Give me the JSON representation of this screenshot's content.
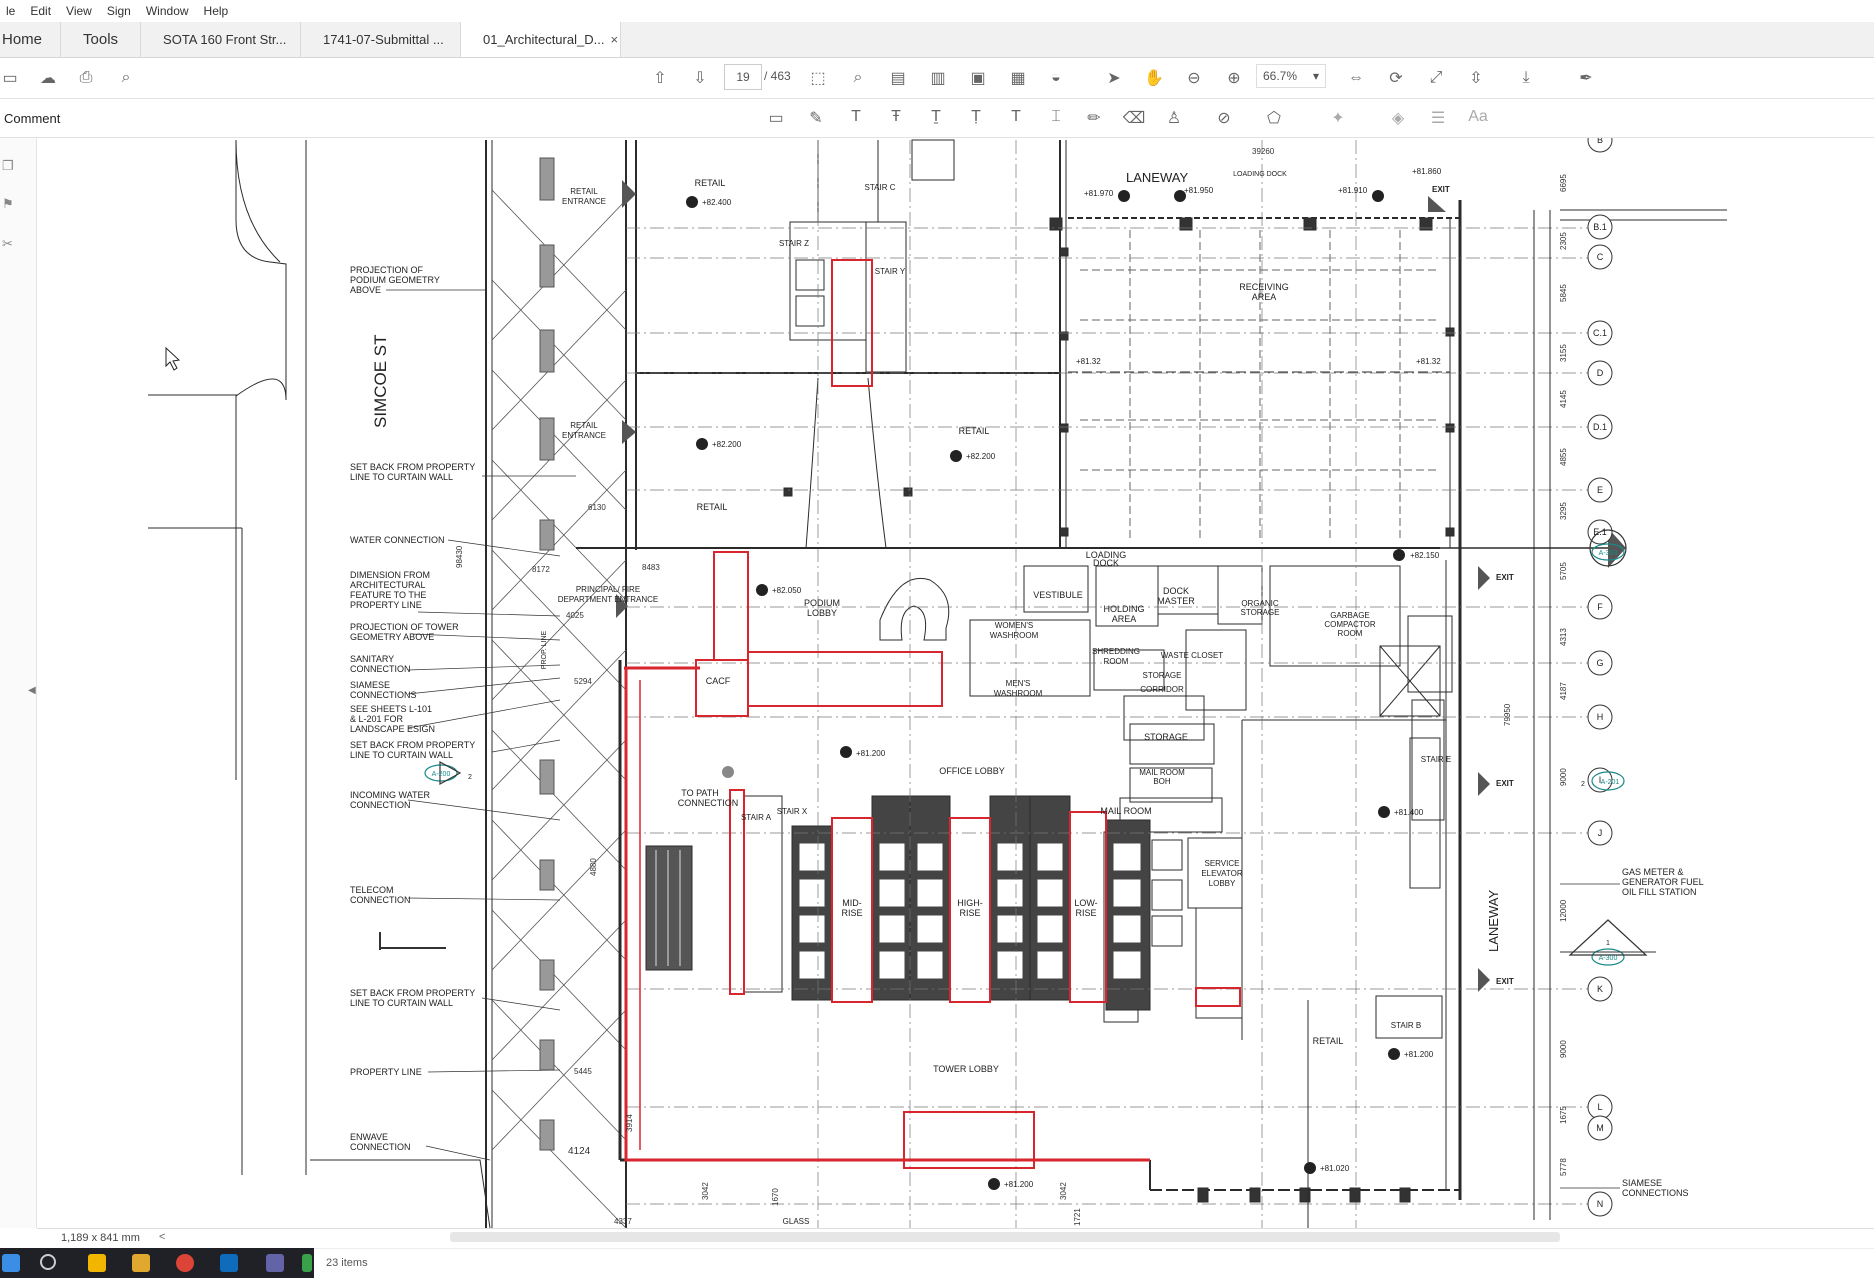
{
  "menu": [
    "le",
    "Edit",
    "View",
    "Sign",
    "Window",
    "Help"
  ],
  "tabs": {
    "home": "Home",
    "tools": "Tools",
    "docs": [
      "SOTA 160 Front Str...",
      "1741-07-Submittal ..."
    ],
    "active": "01_Architectural_D...",
    "close_glyph": "×"
  },
  "toolbar": {
    "page_current": "19",
    "page_total": "/ 463",
    "zoom": "66.7%",
    "zoom_caret": "▾"
  },
  "comment_bar": {
    "label": "Comment"
  },
  "status": {
    "dimensions": "1,189 x 841 mm",
    "chevron": "<"
  },
  "explorer": {
    "items": "23 items"
  },
  "drawing": {
    "street": "SIMCOE ST",
    "laneway_top": "LANEWAY",
    "laneway_right": "LANEWAY",
    "grid_labels": [
      "B",
      "B.1",
      "C",
      "C.1",
      "D",
      "D.1",
      "E",
      "E.1",
      "F",
      "G",
      "H",
      "I",
      "J",
      "K",
      "L",
      "M",
      "N"
    ],
    "grid_dims": [
      "6695",
      "2305",
      "5845",
      "3155",
      "4145",
      "4855",
      "3295",
      "5705",
      "4313",
      "4187",
      "9000",
      "12000",
      "9000",
      "1675",
      "5778"
    ],
    "left_notes": [
      "PROJECTION OF",
      "PODIUM GEOMETRY",
      "ABOVE",
      "SET BACK FROM PROPERTY",
      "LINE TO CURTAIN WALL",
      "WATER CONNECTION",
      "DIMENSION FROM",
      "ARCHITECTURAL",
      "FEATURE TO THE",
      "PROPERTY LINE",
      "PROJECTION OF TOWER",
      "GEOMETRY ABOVE",
      "SANITARY",
      "CONNECTION",
      "SIAMESE",
      "CONNECTIONS",
      "SEE SHEETS L-101",
      "& L-201 FOR",
      "LANDSCAPE ESIGN",
      "SET BACK FROM PROPERTY",
      "LINE TO CURTAIN WALL",
      "INCOMING WATER",
      "CONNECTION",
      "TELECOM",
      "CONNECTION",
      "SET BACK FROM PROPERTY",
      "LINE TO CURTAIN WALL",
      "PROPERTY LINE",
      "ENWAVE",
      "CONNECTION"
    ],
    "right_notes": [
      "GAS METER &",
      "GENERATOR FUEL",
      "OIL FILL STATION",
      "SIAMESE",
      "CONNECTIONS"
    ],
    "rooms": {
      "retail": "RETAIL",
      "retail_entrance_1": "RETAIL",
      "retail_entrance_2": "ENTRANCE",
      "stair_c": "STAIR C",
      "stair_z": "STAIR Z",
      "stair_y": "STAIR Y",
      "stair_a": "STAIR A",
      "stair_x": "STAIR X",
      "stair_e": "STAIR E",
      "stair_b": "STAIR B",
      "loading_dock_top": "LOADING DOCK",
      "receiving_1": "RECEIVING",
      "receiving_2": "AREA",
      "loading_dock_1": "LOADING",
      "loading_dock_2": "DOCK",
      "vestibule": "VESTIBULE",
      "holding_1": "HOLDING",
      "holding_2": "AREA",
      "dock_master_1": "DOCK",
      "dock_master_2": "MASTER",
      "organic_1": "ORGANIC",
      "organic_2": "STORAGE",
      "garbage_1": "GARBAGE",
      "garbage_2": "COMPACTOR",
      "garbage_3": "ROOM",
      "womens_1": "WOMEN'S",
      "womens_2": "WASHROOM",
      "mens_1": "MEN'S",
      "mens_2": "WASHROOM",
      "shredding_1": "SHREDDING",
      "shredding_2": "ROOM",
      "waste_closet": "WASTE CLOSET",
      "storage_corridor_1": "STORAGE",
      "storage_corridor_2": "CORRIDOR",
      "storage": "STORAGE",
      "mail_boh_1": "MAIL ROOM",
      "mail_boh_2": "BOH",
      "mail_room": "MAIL ROOM",
      "principal_1": "PRINCIPAL/ FIRE",
      "principal_2": "DEPARTMENT ENTRANCE",
      "podium_1": "PODIUM",
      "podium_2": "LOBBY",
      "cacf": "CACF",
      "office_lobby": "OFFICE LOBBY",
      "to_path_1": "TO PATH",
      "to_path_2": "CONNECTION",
      "mid_1": "MID-",
      "mid_2": "RISE",
      "high_1": "HIGH-",
      "high_2": "RISE",
      "low_1": "LOW-",
      "low_2": "RISE",
      "service_1": "SERVICE",
      "service_2": "ELEVATOR",
      "service_3": "LOBBY",
      "tower_lobby": "TOWER LOBBY",
      "glass": "GLASS",
      "prop_line": "PROP. LINE"
    },
    "exits": [
      "EXIT",
      "EXIT",
      "EXIT",
      "EXIT"
    ],
    "elevations": [
      "+82.400",
      "+82.200",
      "+82.200",
      "+81.970",
      "+81.950",
      "+81.910",
      "+81.860",
      "+81.32",
      "+81.32",
      "+82.150",
      "+82.050",
      "+81.200",
      "+81.400",
      "+81.200",
      "+81.020",
      "+81.200"
    ],
    "dims_misc": [
      "39260",
      "6130",
      "8483",
      "8172",
      "98430",
      "4025",
      "5294",
      "4880",
      "5445",
      "4124",
      "3914",
      "79950",
      "1670",
      "3042",
      "3042",
      "1721",
      "4337"
    ],
    "callouts": [
      "A-303",
      "A-201",
      "A-200",
      "A-300"
    ],
    "callout_nums": [
      "2",
      "2",
      "1"
    ]
  },
  "colors": {
    "accent_red": "#d8262f",
    "line": "#2b2b2b",
    "callout": "#1a8a8a"
  }
}
